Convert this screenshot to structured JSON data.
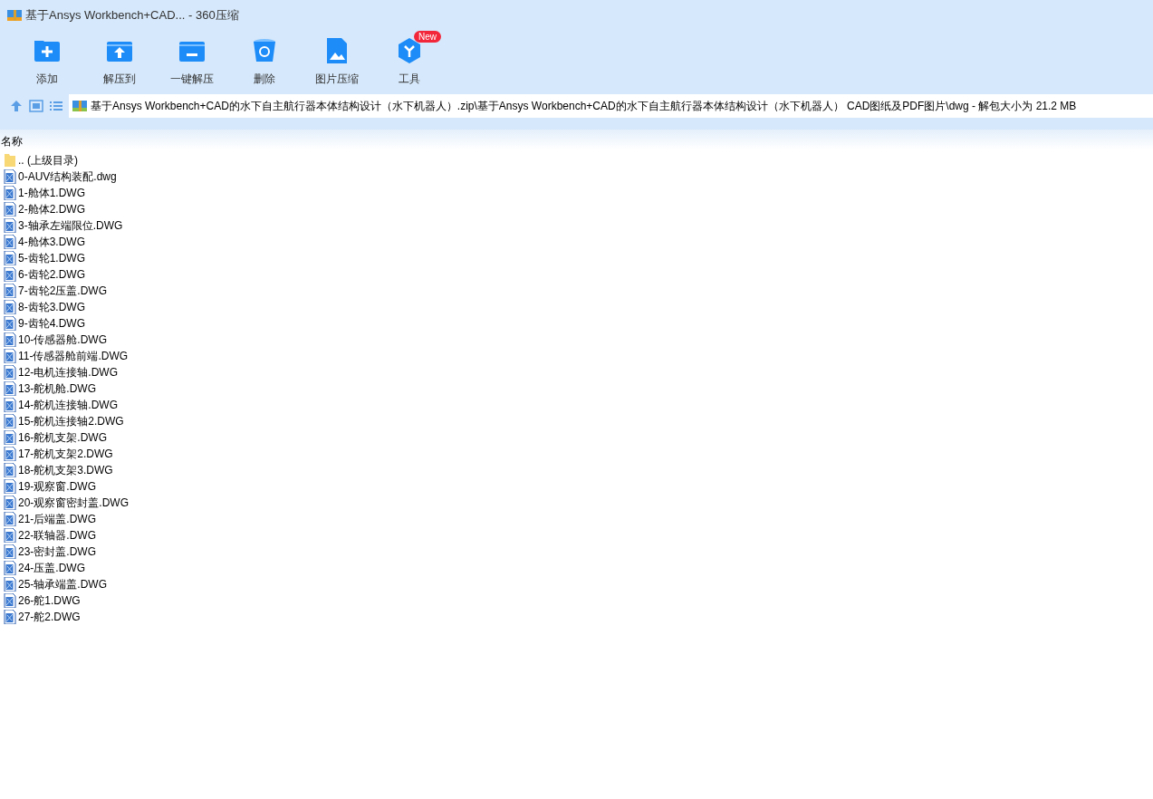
{
  "window": {
    "title": "基于Ansys Workbench+CAD... - 360压缩"
  },
  "toolbar": [
    {
      "kind": "add",
      "label": "添加"
    },
    {
      "kind": "extract",
      "label": "解压到"
    },
    {
      "kind": "oneclick",
      "label": "一键解压"
    },
    {
      "kind": "delete",
      "label": "删除"
    },
    {
      "kind": "image",
      "label": "图片压缩"
    },
    {
      "kind": "tools",
      "label": "工具",
      "badge": "New"
    }
  ],
  "path": "基于Ansys Workbench+CAD的水下自主航行器本体结构设计（水下机器人）.zip\\基于Ansys Workbench+CAD的水下自主航行器本体结构设计（水下机器人） CAD图纸及PDF图片\\dwg - 解包大小为 21.2 MB",
  "column": "名称",
  "files": [
    {
      "kind": "folder",
      "name": ".. (上级目录)"
    },
    {
      "kind": "dwg",
      "name": "0-AUV结构装配.dwg"
    },
    {
      "kind": "dwg",
      "name": "1-舱体1.DWG"
    },
    {
      "kind": "dwg",
      "name": "2-舱体2.DWG"
    },
    {
      "kind": "dwg",
      "name": "3-轴承左端限位.DWG"
    },
    {
      "kind": "dwg",
      "name": "4-舱体3.DWG"
    },
    {
      "kind": "dwg",
      "name": "5-齿轮1.DWG"
    },
    {
      "kind": "dwg",
      "name": "6-齿轮2.DWG"
    },
    {
      "kind": "dwg",
      "name": "7-齿轮2压盖.DWG"
    },
    {
      "kind": "dwg",
      "name": "8-齿轮3.DWG"
    },
    {
      "kind": "dwg",
      "name": "9-齿轮4.DWG"
    },
    {
      "kind": "dwg",
      "name": "10-传感器舱.DWG"
    },
    {
      "kind": "dwg",
      "name": "11-传感器舱前端.DWG"
    },
    {
      "kind": "dwg",
      "name": "12-电机连接轴.DWG"
    },
    {
      "kind": "dwg",
      "name": "13-舵机舱.DWG"
    },
    {
      "kind": "dwg",
      "name": "14-舵机连接轴.DWG"
    },
    {
      "kind": "dwg",
      "name": "15-舵机连接轴2.DWG"
    },
    {
      "kind": "dwg",
      "name": "16-舵机支架.DWG"
    },
    {
      "kind": "dwg",
      "name": "17-舵机支架2.DWG"
    },
    {
      "kind": "dwg",
      "name": "18-舵机支架3.DWG"
    },
    {
      "kind": "dwg",
      "name": "19-观察窗.DWG"
    },
    {
      "kind": "dwg",
      "name": "20-观察窗密封盖.DWG"
    },
    {
      "kind": "dwg",
      "name": "21-后端盖.DWG"
    },
    {
      "kind": "dwg",
      "name": "22-联轴器.DWG"
    },
    {
      "kind": "dwg",
      "name": "23-密封盖.DWG"
    },
    {
      "kind": "dwg",
      "name": "24-压盖.DWG"
    },
    {
      "kind": "dwg",
      "name": "25-轴承端盖.DWG"
    },
    {
      "kind": "dwg",
      "name": "26-舵1.DWG"
    },
    {
      "kind": "dwg",
      "name": "27-舵2.DWG"
    }
  ]
}
